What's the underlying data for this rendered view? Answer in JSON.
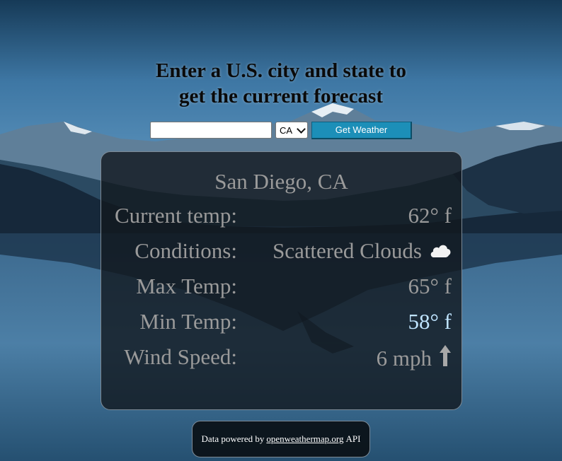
{
  "header": {
    "title_line1": "Enter a U.S. city and state to",
    "title_line2": "get the current forecast"
  },
  "form": {
    "city_value": "",
    "state_selected": "CA",
    "button_label": "Get Weather"
  },
  "weather": {
    "location": "San Diego, CA",
    "rows": [
      {
        "label": "Current temp:",
        "value": "62° f"
      },
      {
        "label": "Conditions:",
        "value": "Scattered Clouds",
        "icon": "cloud-icon"
      },
      {
        "label": "Max Temp:",
        "value": "65° f"
      },
      {
        "label": "Min Temp:",
        "value": "58° f"
      },
      {
        "label": "Wind Speed:",
        "value": "6 mph",
        "icon": "wind-direction-arrow-icon"
      }
    ]
  },
  "footer": {
    "prefix": "Data powered by",
    "link": "openweathermap.org",
    "suffix": "API"
  },
  "colors": {
    "button": "#1c8fb8",
    "card_text": "#9a9a9a",
    "min_temp": "#bfe4ff"
  }
}
